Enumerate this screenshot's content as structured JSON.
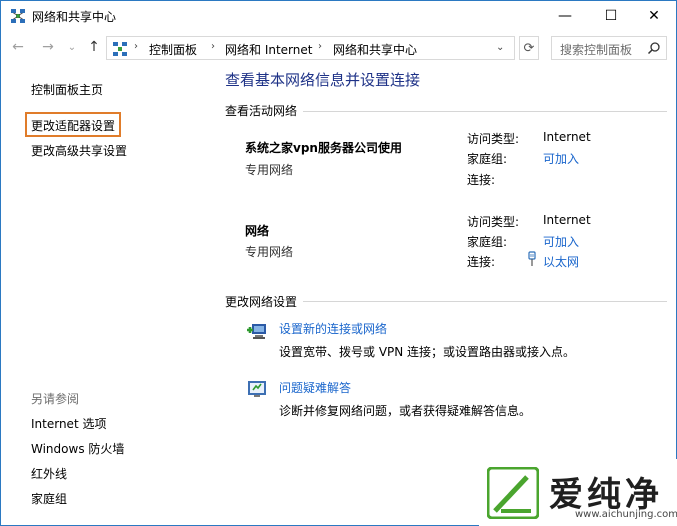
{
  "window": {
    "title": "网络和共享中心",
    "minimize": "—",
    "maximize": "☐",
    "close": "✕"
  },
  "address": {
    "back": "←",
    "forward": "→",
    "history": "⌄",
    "up": "↑",
    "crumbs": [
      "控制面板",
      "网络和 Internet",
      "网络和共享中心"
    ],
    "separator": "›",
    "dropdown": "⌄",
    "refresh": "⟳",
    "search_placeholder": "搜索控制面板"
  },
  "left": {
    "home": "控制面板主页",
    "adapter": "更改适配器设置",
    "advanced": "更改高级共享设置",
    "see_also": "另请参阅",
    "links": [
      "Internet 选项",
      "Windows 防火墙",
      "红外线",
      "家庭组"
    ]
  },
  "main": {
    "title": "查看基本网络信息并设置连接",
    "active_header": "查看活动网络",
    "networks": [
      {
        "name": "系统之家vpn服务器公司使用",
        "type": "专用网络",
        "access_label": "访问类型:",
        "access_value": "Internet",
        "homegroup_label": "家庭组:",
        "homegroup_value": "可加入",
        "conn_label": "连接:",
        "conn_value": ""
      },
      {
        "name": "网络",
        "type": "专用网络",
        "access_label": "访问类型:",
        "access_value": "Internet",
        "homegroup_label": "家庭组:",
        "homegroup_value": "可加入",
        "conn_label": "连接:",
        "conn_value": "以太网"
      }
    ],
    "change_header": "更改网络设置",
    "tasks": [
      {
        "link": "设置新的连接或网络",
        "desc": "设置宽带、拨号或 VPN 连接；或设置路由器或接入点。"
      },
      {
        "link": "问题疑难解答",
        "desc": "诊断并修复网络问题，或者获得疑难解答信息。"
      }
    ]
  },
  "watermark": {
    "text": "爱纯净",
    "url": "www.aichunjing.com"
  }
}
